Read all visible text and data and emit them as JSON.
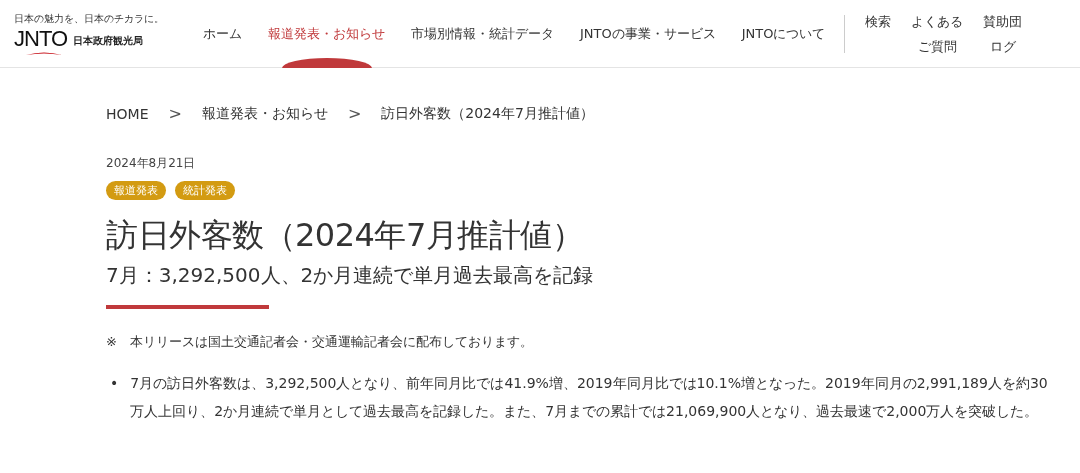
{
  "header": {
    "logo": {
      "tagline": "日本の魅力を、日本のチカラに。",
      "name": "JNTO",
      "subtitle": "日本政府観光局"
    },
    "nav": [
      {
        "label": "ホーム",
        "selected": false
      },
      {
        "label": "報道発表・お知らせ",
        "selected": true
      },
      {
        "label": "市場別情報・統計データ",
        "selected": false
      },
      {
        "label": "JNTOの事業・サービス",
        "selected": false
      },
      {
        "label": "JNTOについて",
        "selected": false
      }
    ],
    "utility": [
      {
        "lines": [
          "検索"
        ]
      },
      {
        "lines": [
          "よくある",
          "ご質問"
        ]
      },
      {
        "lines": [
          "賛助団",
          "ログ"
        ]
      }
    ]
  },
  "breadcrumb": [
    "HOME",
    "報道発表・お知らせ",
    "訪日外客数（2024年7月推計値）"
  ],
  "breadcrumb_separator": ">",
  "article": {
    "date": "2024年8月21日",
    "tags": [
      "報道発表",
      "統計発表"
    ],
    "title": "訪日外客数（2024年7月推計値）",
    "subtitle": "7月：3,292,500人、2か月連続で単月過去最高を記録",
    "note": "※　本リリースは国土交通記者会・交通運輸記者会に配布しております。",
    "bullet_marker": "•",
    "bullets": [
      "7月の訪日外客数は、3,292,500人となり、前年同月比では41.9%増、2019年同月比では10.1%増となった。2019年同月の2,991,189人を約30万人上回り、2か月連続で単月として過去最高を記録した。また、7月までの累計では21,069,900人となり、過去最速で2,000万人を突破した。"
    ]
  }
}
